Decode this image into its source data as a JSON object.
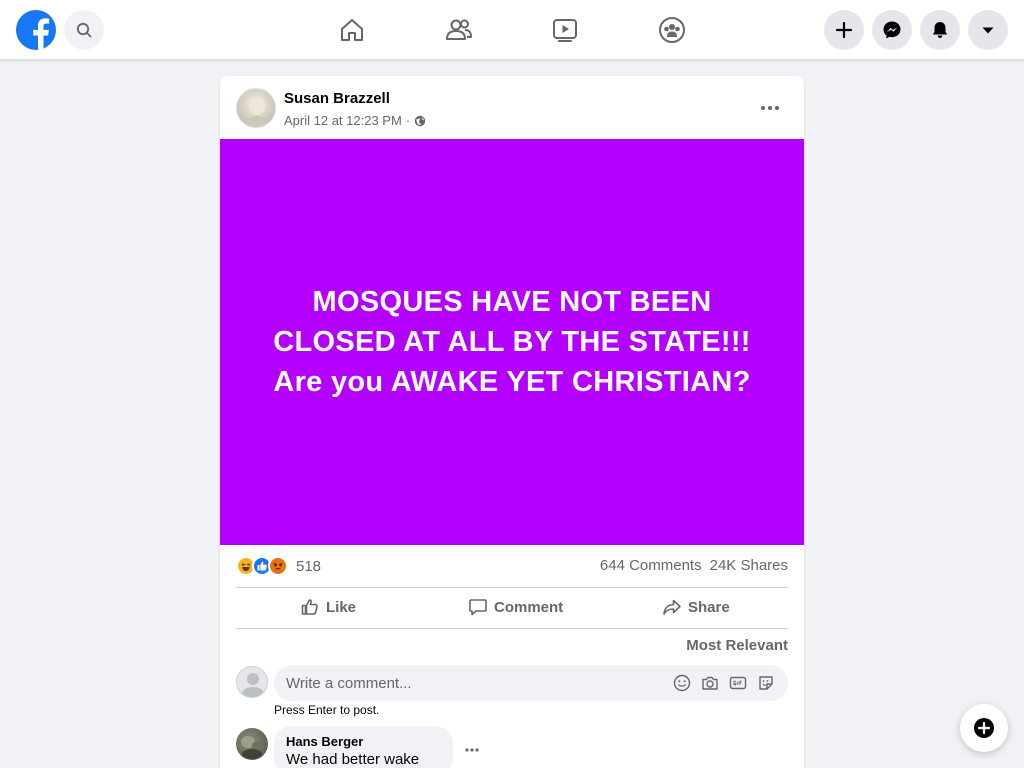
{
  "nav": {
    "logo_icon": "facebook-logo",
    "search_icon": "search-icon",
    "center_icons": [
      "home-icon",
      "friends-icon",
      "watch-icon",
      "groups-icon"
    ],
    "right_icons": [
      "plus-icon",
      "messenger-icon",
      "notifications-icon",
      "account-menu-icon"
    ]
  },
  "post": {
    "author": "Susan Brazzell",
    "timestamp": "April 12 at 12:23 PM",
    "separator": "·",
    "privacy_icon": "globe-icon",
    "image_text": {
      "line1": "MOSQUES HAVE NOT BEEN",
      "line2": "CLOSED AT ALL BY THE STATE!!!",
      "line3": "Are you AWAKE YET CHRISTIAN?"
    },
    "image_bg": "#b300ff",
    "reactions": [
      "haha",
      "like",
      "angry"
    ],
    "reaction_count": "518",
    "comments_count": "644 Comments",
    "shares_count": "24K Shares"
  },
  "actions": {
    "like": "Like",
    "comment": "Comment",
    "share": "Share"
  },
  "comments": {
    "sort_label": "Most Relevant",
    "input_placeholder": "Write a comment...",
    "input_icons": [
      "emoji-icon",
      "camera-icon",
      "gif-icon",
      "sticker-icon"
    ],
    "hint": "Press Enter to post.",
    "items": [
      {
        "name": "Hans Berger",
        "text": "We had better wake up!"
      }
    ]
  },
  "colors": {
    "brand": "#1877f2",
    "muted": "#65676b",
    "image_bg": "#b300ff"
  }
}
